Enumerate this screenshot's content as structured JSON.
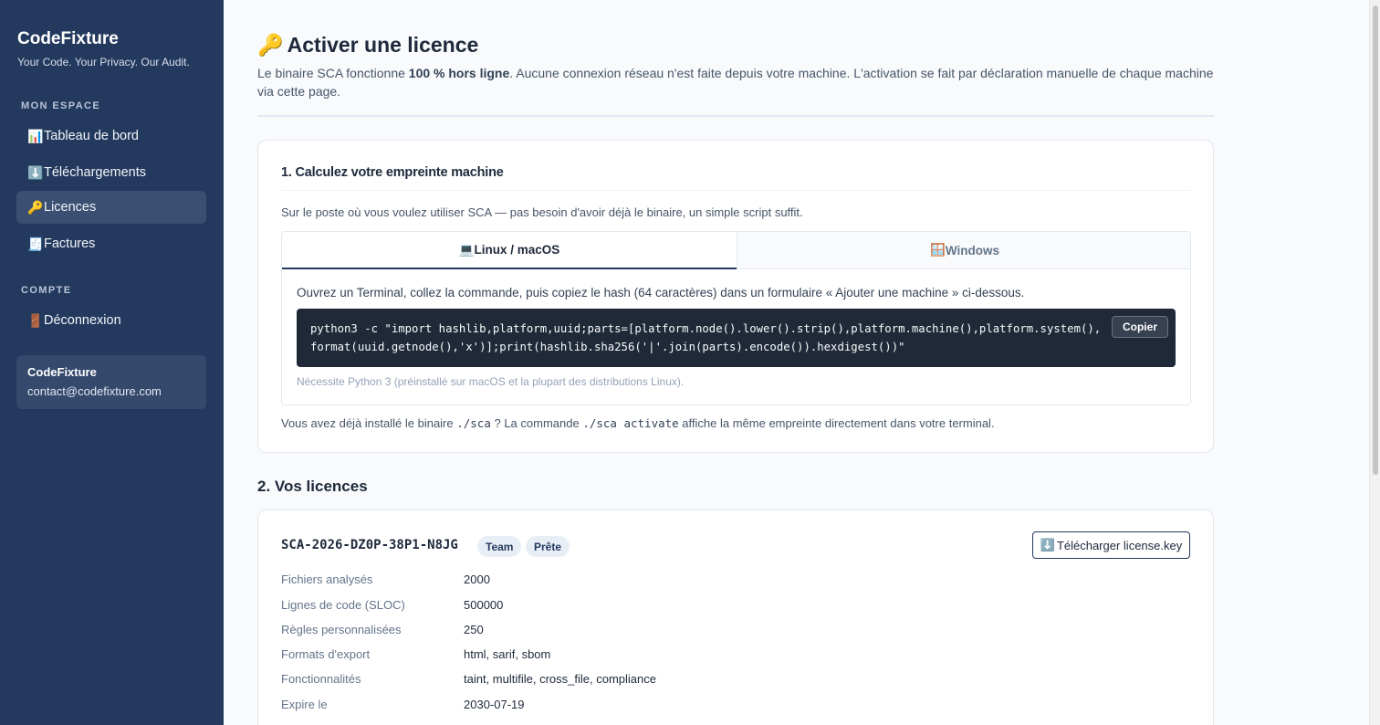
{
  "sidebar": {
    "brand": "CodeFixture",
    "tagline": "Your Code. Your Privacy. Our Audit.",
    "section_space": "MON ESPACE",
    "section_account": "COMPTE",
    "items": [
      {
        "icon": "📊",
        "label": "Tableau de bord",
        "active": false
      },
      {
        "icon": "⬇️",
        "label": "Téléchargements",
        "active": false
      },
      {
        "icon": "🔑",
        "label": "Licences",
        "active": true
      },
      {
        "icon": "🧾",
        "label": "Factures",
        "active": false
      }
    ],
    "logout": {
      "icon": "🚪",
      "label": "Déconnexion"
    },
    "user": {
      "name": "CodeFixture",
      "email": "contact@codefixture.com"
    }
  },
  "page": {
    "title_icon": "🔑",
    "title": "Activer une licence",
    "intro_prefix": "Le binaire SCA fonctionne ",
    "intro_bold": "100 % hors ligne",
    "intro_suffix": ". Aucune connexion réseau n'est faite depuis votre machine. L'activation se fait par déclaration manuelle de chaque machine via cette page."
  },
  "step1": {
    "heading": "1. Calculez votre empreinte machine",
    "description": "Sur le poste où vous voulez utiliser SCA — pas besoin d'avoir déjà le binaire, un simple script suffit.",
    "tabs": [
      {
        "icon": "💻",
        "label": "Linux / macOS",
        "active": true
      },
      {
        "icon": "🪟",
        "label": "Windows",
        "active": false
      }
    ],
    "instructions": "Ouvrez un Terminal, collez la commande, puis copiez le hash (64 caractères) dans un formulaire « Ajouter une machine » ci-dessous.",
    "code_line1": "python3 -c \"import hashlib,platform,uuid;parts=[platform.node().lower().strip(),platform.machine(),platform.system(),",
    "code_line2": "format(uuid.getnode(),'x')];print(hashlib.sha256('|'.join(parts).encode()).hexdigest())\"",
    "copy_label": "Copier",
    "note": "Nécessite Python 3 (préinstallé sur macOS et la plupart des distributions Linux).",
    "footer_a": "Vous avez déjà installé le binaire ",
    "footer_code1": "./sca",
    "footer_b": " ? La commande ",
    "footer_code2": "./sca activate",
    "footer_c": " affiche la même empreinte directement dans votre terminal."
  },
  "step2": {
    "heading": "2. Vos licences",
    "license": {
      "key": "SCA-2026-DZ0P-38P1-N8JG",
      "badges": [
        "Team",
        "Prête"
      ],
      "download_icon": "⬇️",
      "download_label": "Télécharger license.key",
      "fields": [
        {
          "label": "Fichiers analysés",
          "value": "2000"
        },
        {
          "label": "Lignes de code (SLOC)",
          "value": "500000"
        },
        {
          "label": "Règles personnalisées",
          "value": "250"
        },
        {
          "label": "Formats d'export",
          "value": "html, sarif, sbom"
        },
        {
          "label": "Fonctionnalités",
          "value": "taint, multifile, cross_file, compliance"
        },
        {
          "label": "Expire le",
          "value": "2030-07-19"
        }
      ]
    }
  }
}
